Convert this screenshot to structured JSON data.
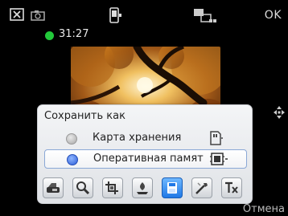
{
  "topbar": {
    "ok_label": "OK",
    "icons": [
      "close-icon",
      "camera-icon",
      "device-icon",
      "network-icon"
    ]
  },
  "status": {
    "timer": "31:27",
    "status_color": "#22c83a"
  },
  "dialog": {
    "title": "Сохранить как",
    "options": [
      {
        "label": "Карта хранения",
        "selected": false,
        "icon": "storage-card-icon"
      },
      {
        "label": "Оперативная памят",
        "selected": true,
        "icon": "memory-icon"
      }
    ],
    "toolbar_icons": [
      "quick-save-icon",
      "zoom-icon",
      "crop-icon",
      "effect-icon",
      "save-icon",
      "tools-icon",
      "text-icon"
    ],
    "active_tool_index": 4
  },
  "bottombar": {
    "cancel_label": "Отмена"
  },
  "colors": {
    "selected_blue": "#2d5ed8",
    "active_tool": "#1f78e6"
  }
}
